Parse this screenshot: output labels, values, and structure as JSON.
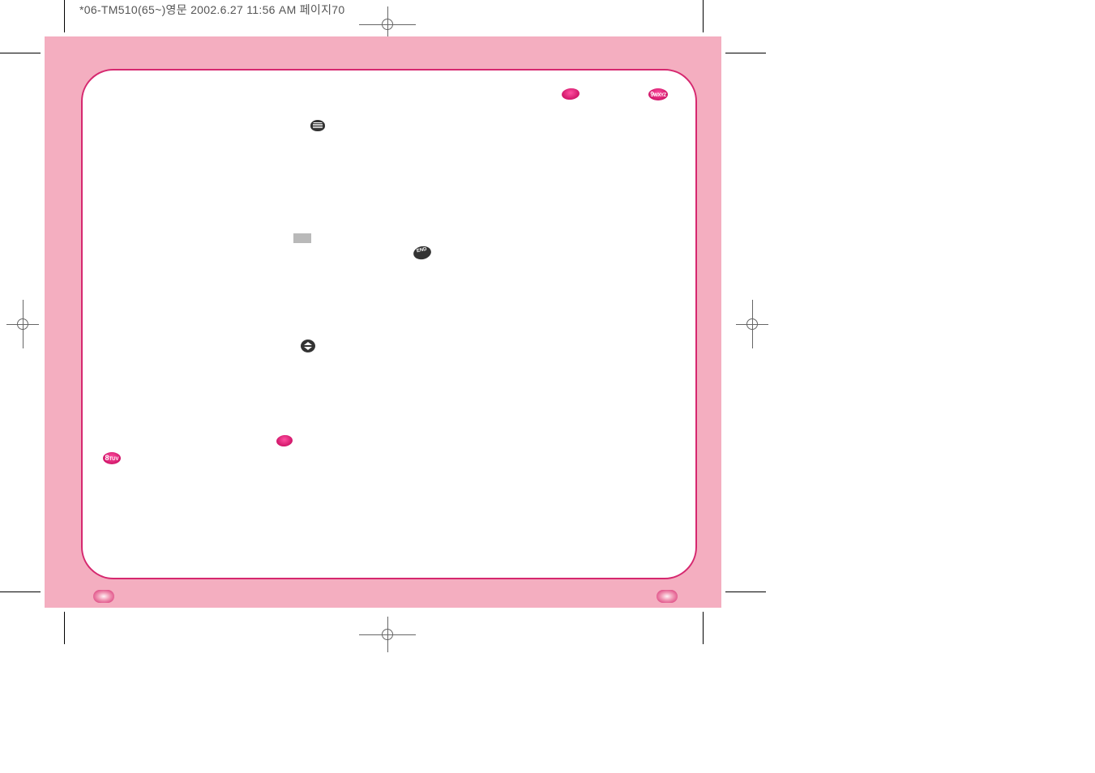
{
  "header_text": "*06-TM510(65~)영문  2002.6.27 11:56 AM  페이지70",
  "icons": {
    "end_label": "END"
  },
  "colors": {
    "pink_bg": "#f4aec0",
    "accent": "#d6286f"
  }
}
